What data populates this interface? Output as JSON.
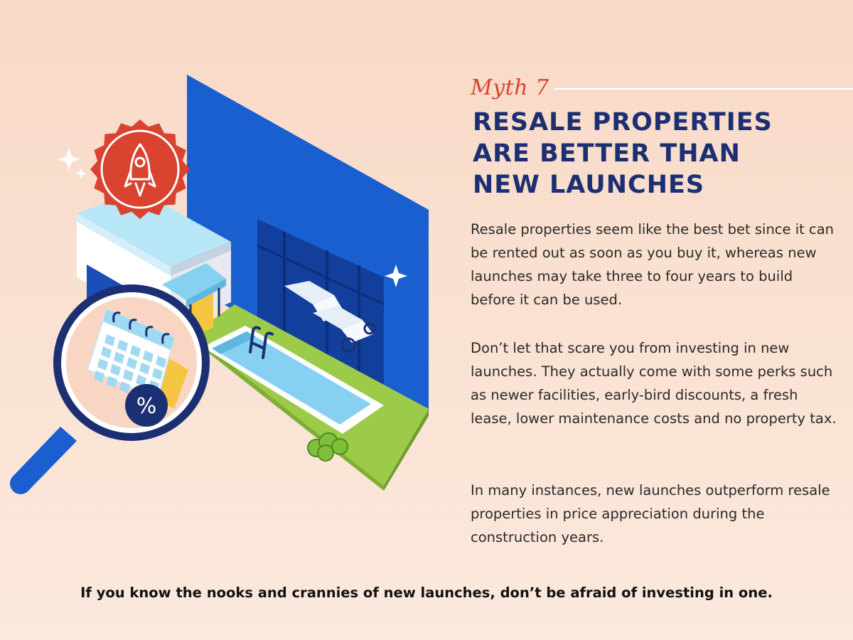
{
  "header": {
    "myth_label": "Myth 7",
    "headline_lines": [
      "RESALE PROPERTIES",
      "ARE BETTER THAN",
      "NEW LAUNCHES"
    ]
  },
  "body": {
    "paragraphs": [
      "Resale properties seem like the best bet since it can be rented out as soon as you buy it, whereas new launches may take three to four years to build before it can be used.",
      "Don’t let that scare you from investing in new launches. They actually come with some perks such as newer facilities, early-bird discounts, a fresh lease, lower maintenance costs and no property tax.",
      "In many instances, new launches outperform resale properties in price appreciation during the construction years."
    ]
  },
  "footer": {
    "tagline": "If you know the nooks and crannies of new launches, don’t be afraid of investing in one."
  },
  "illustration": {
    "badge_icon": "rocket-icon",
    "percent_symbol": "%",
    "colors": {
      "accent_red": "#d9432f",
      "navy": "#1b2f72",
      "wall_blue": "#1a5fd0",
      "grass_green": "#9ccb4a",
      "pool_blue": "#86d1f2",
      "calendar_yellow": "#f5c542"
    }
  }
}
